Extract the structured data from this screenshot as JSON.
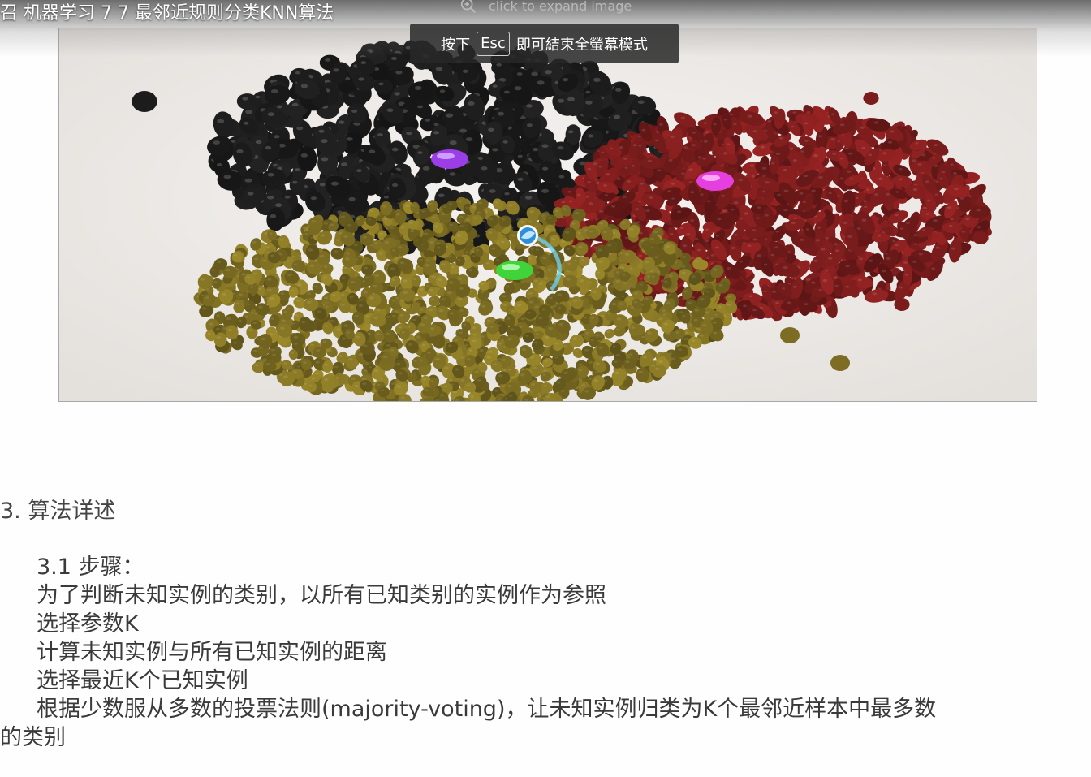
{
  "video": {
    "title": "召 机器学习 7 7 最邻近规则分类KNN算法",
    "expand_hint": "click to expand image"
  },
  "fullscreen_notice": {
    "prefix": "按下",
    "key": "Esc",
    "suffix": "即可結束全螢幕模式"
  },
  "article": {
    "section_heading": "3. 算法详述",
    "subheading": "3.1 步骤：",
    "steps": [
      "为了判断未知实例的类别，以所有已知类别的实例作为参照",
      "选择参数K",
      "计算未知实例与所有已知实例的距离",
      "选择最近K个已知实例",
      "根据少数服从多数的投票法则(majority-voting)，让未知实例归类为K个最邻近样本中最多数"
    ],
    "continuation": "的类别"
  },
  "figure": {
    "colors": {
      "black_beans": "#1c1c1c",
      "red_beans": "#7a1c1c",
      "mung_beans": "#7c6d22",
      "marker_purple": "#9b3ee8",
      "marker_magenta": "#e53fe0",
      "marker_green": "#3fd43a",
      "marker_blue": "#3aa3e0"
    },
    "icons": [
      "zoom-in-icon"
    ]
  }
}
